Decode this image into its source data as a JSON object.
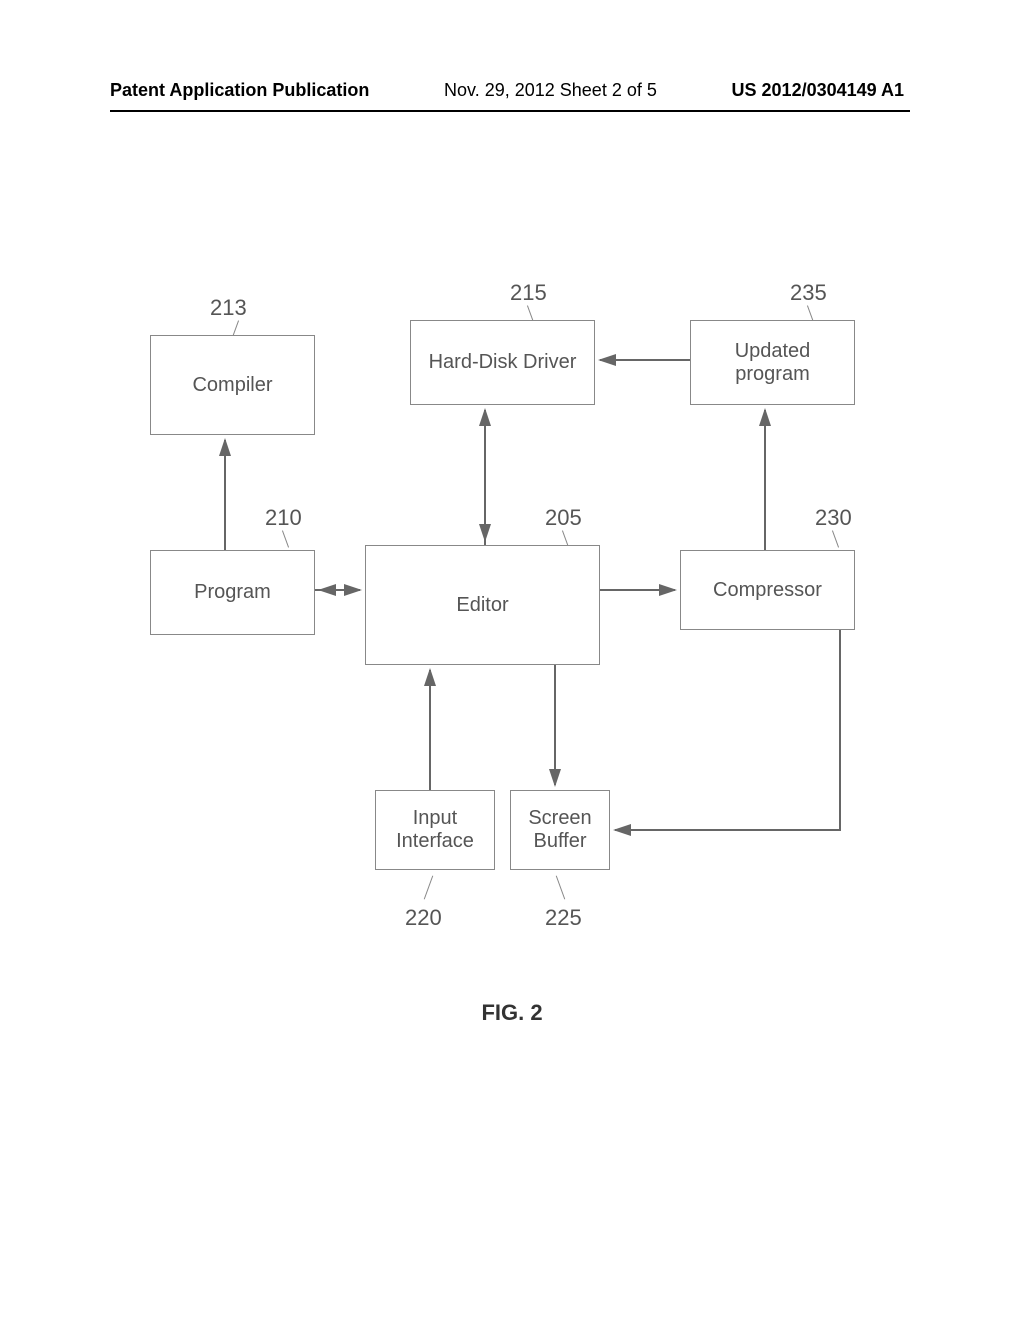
{
  "header": {
    "left": "Patent Application Publication",
    "center": "Nov. 29, 2012  Sheet 2 of 5",
    "right": "US 2012/0304149 A1"
  },
  "labels": {
    "l213": "213",
    "l215": "215",
    "l235": "235",
    "l210": "210",
    "l205": "205",
    "l230": "230",
    "l220": "220",
    "l225": "225"
  },
  "boxes": {
    "compiler": "Compiler",
    "hard_disk_driver": "Hard-Disk Driver",
    "updated_program": "Updated program",
    "program": "Program",
    "editor": "Editor",
    "compressor": "Compressor",
    "input_interface": "Input Interface",
    "screen_buffer": "Screen Buffer"
  },
  "caption": "FIG. 2"
}
